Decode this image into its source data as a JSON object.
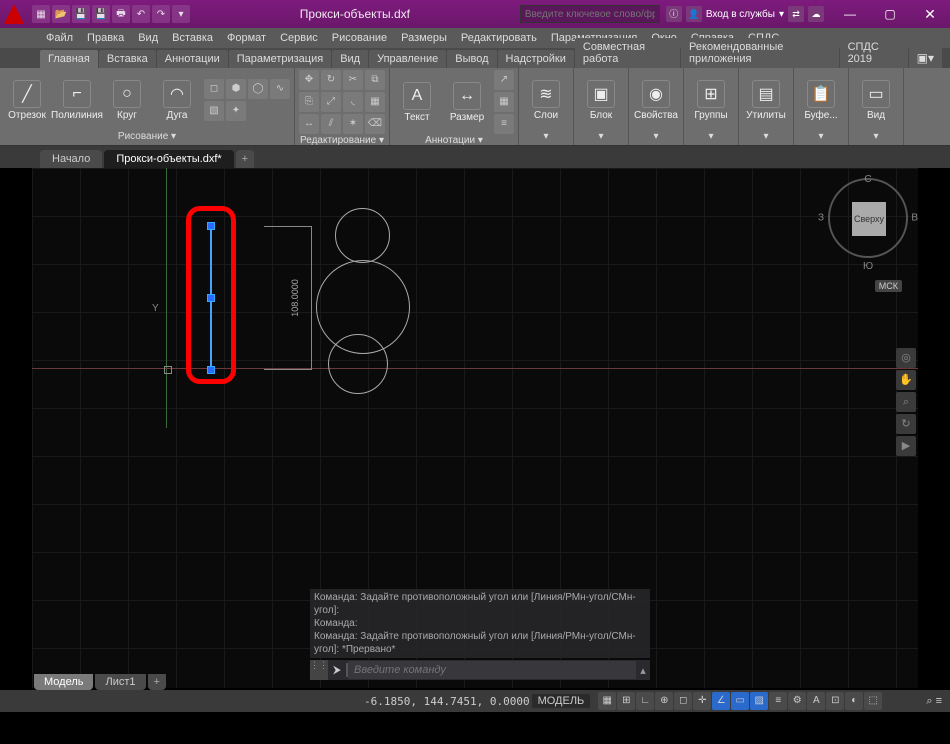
{
  "title": "Прокси-объекты.dxf",
  "search_placeholder": "Введите ключевое слово/фразу",
  "signin": "Вход в службы",
  "menu": [
    "Файл",
    "Правка",
    "Вид",
    "Вставка",
    "Формат",
    "Сервис",
    "Рисование",
    "Размеры",
    "Редактировать",
    "Параметризация",
    "Окно",
    "Справка",
    "СПДС"
  ],
  "ribbon_tabs": [
    "Главная",
    "Вставка",
    "Аннотации",
    "Параметризация",
    "Вид",
    "Управление",
    "Вывод",
    "Надстройки",
    "Совместная работа",
    "Рекомендованные приложения",
    "СПДС 2019"
  ],
  "panels": {
    "draw": {
      "label": "Рисование ▾",
      "tools": [
        "Отрезок",
        "Полилиния",
        "Круг",
        "Дуга"
      ]
    },
    "modify": {
      "label": "Редактирование ▾"
    },
    "annot": {
      "label": "Аннотации ▾",
      "tools": [
        "Текст",
        "Размер"
      ]
    },
    "layers": {
      "label": "Слои"
    },
    "block": {
      "label": "Блок"
    },
    "props": {
      "label": "Свойства"
    },
    "groups": {
      "label": "Группы"
    },
    "util": {
      "label": "Утилиты"
    },
    "clip": {
      "label": "Буфе..."
    },
    "view": {
      "label": "Вид"
    }
  },
  "file_tabs": {
    "start": "Начало",
    "active": "Прокси-объекты.dxf*"
  },
  "viewcube": {
    "face": "Сверху",
    "n": "С",
    "s": "Ю",
    "e": "В",
    "w": "З",
    "wcs": "МСК"
  },
  "axis_y": "Y",
  "dim_text": "108.0000",
  "command_history": [
    "Команда: Задайте противоположный угол или [Линия/РМн-угол/СМн-угол]:",
    "Команда:",
    "Команда: Задайте противоположный угол или [Линия/РМн-угол/СМн-угол]: *Прервано*"
  ],
  "command_placeholder": "Введите команду",
  "layout_tabs": {
    "model": "Модель",
    "sheet": "Лист1"
  },
  "status": {
    "coords": "-6.1850, 144.7451, 0.0000",
    "model": "МОДЕЛЬ",
    "zoom": "⌕ ≡"
  }
}
